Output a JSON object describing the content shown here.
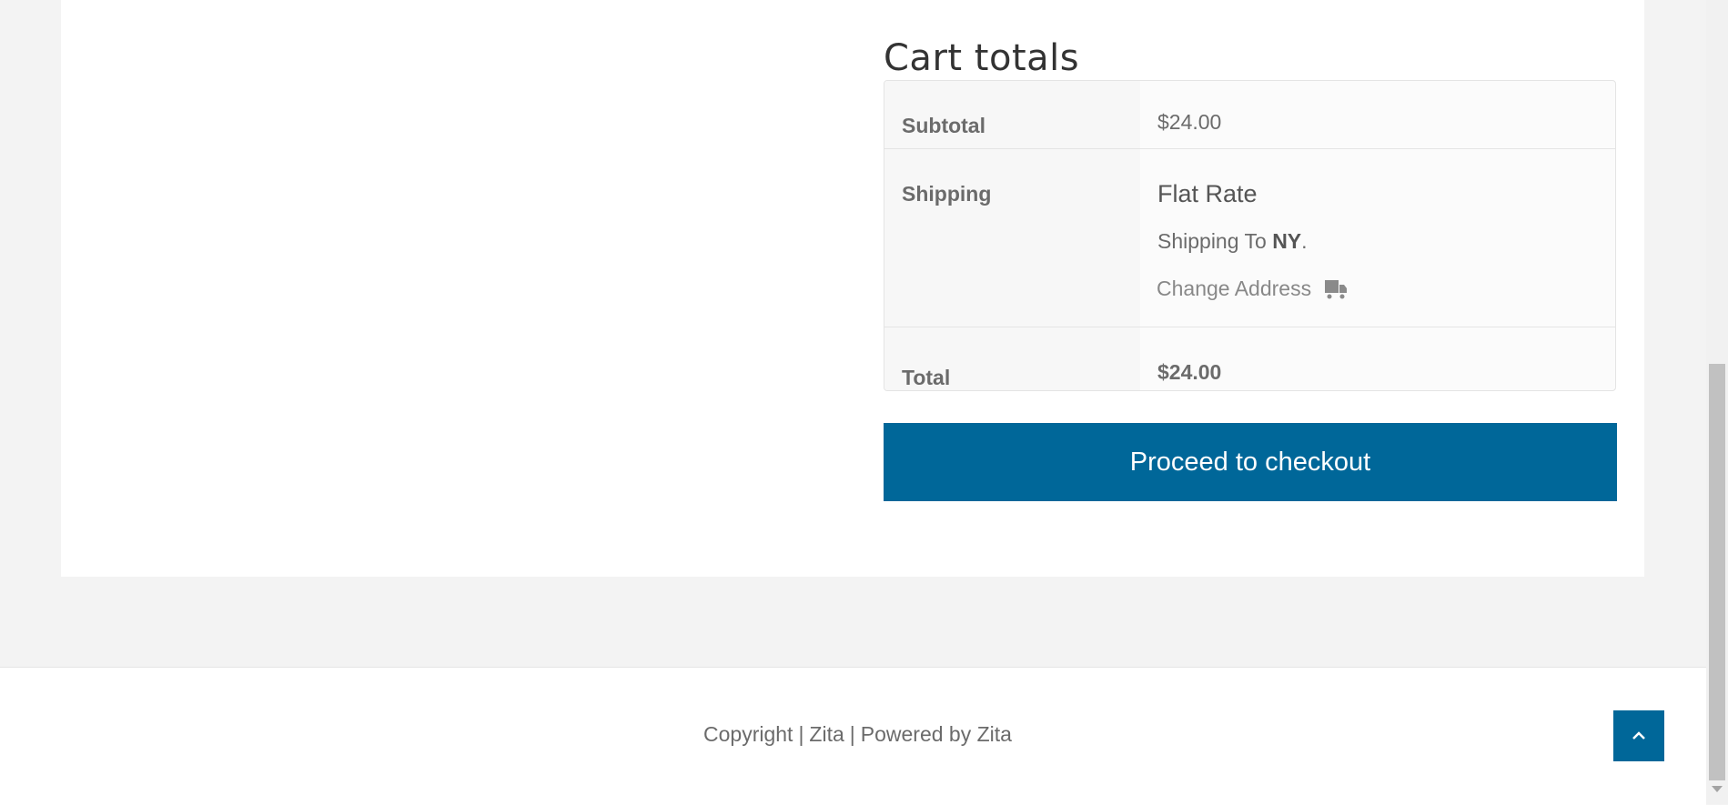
{
  "cart_totals": {
    "title": "Cart totals",
    "subtotal_label": "Subtotal",
    "subtotal_value": "$24.00",
    "shipping_label": "Shipping",
    "shipping_method": "Flat Rate",
    "shipping_to_prefix": "Shipping To ",
    "shipping_to_state": "NY",
    "shipping_to_suffix": ".",
    "change_address_label": "Change Address",
    "change_address_icon": "truck-icon",
    "total_label": "Total",
    "total_value": "$24.00"
  },
  "checkout": {
    "button_label": "Proceed to checkout",
    "color": "#006799"
  },
  "footer": {
    "copyright": "Copyright",
    "separator": "|",
    "brand": "Zita",
    "powered_by": "Powered by Zita",
    "scroll_top_icon": "chevron-up-icon"
  }
}
